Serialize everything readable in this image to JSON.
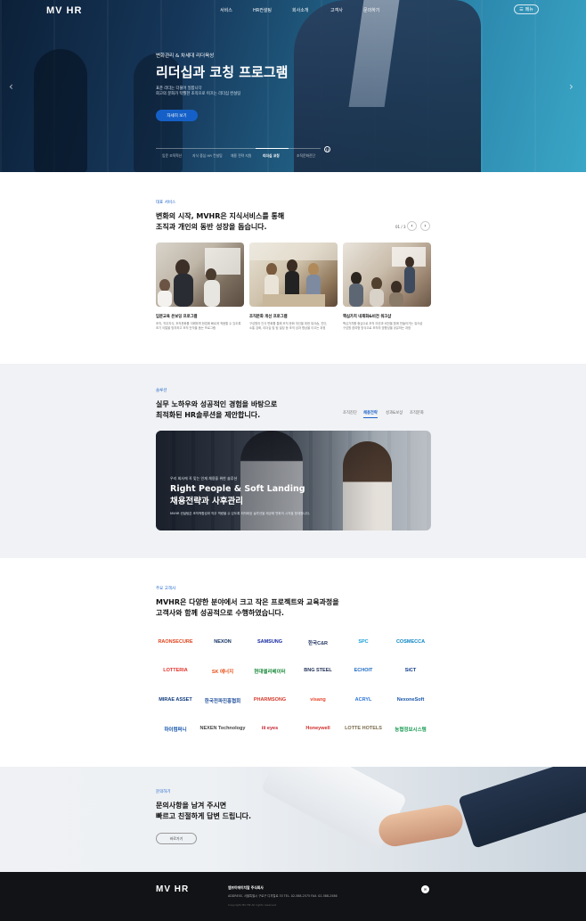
{
  "header": {
    "logo": "MV HR",
    "nav": [
      "서비스",
      "HR컨설팅",
      "회사소개",
      "고객사",
      "문의하기"
    ],
    "menu_label": "메뉴"
  },
  "hero": {
    "eyebrow": "변화관리 & 차세대 리더육성",
    "title": "리더십과 코칭 프로그램",
    "desc_1": "표준 리더는 더불어 일합니다",
    "desc_2": "회고의 문화가 탁월한 조직으로 이끄는 리더십 컨설팅",
    "cta": "자세히 보기",
    "tabs": [
      "입문 조직혁신",
      "지식 중심 HR 컨설팅",
      "채용 전략 지원",
      "리더십 코칭",
      "조직문화진단"
    ],
    "active_tab": 3
  },
  "services": {
    "eyebrow": "대표 서비스",
    "title_1": "변화의 시작, MVHR은 지식서비스를 통해",
    "title_2": "조직과 개인의 동반 성장을 돕습니다.",
    "pager": "01 / 3",
    "cards": [
      {
        "title": "입문교육 온보딩 프로그램",
        "desc_1": "조직, 직무지식, 조직문화를 이해하며 현업에 빠르게 적응할 수 있도록",
        "desc_2": "조기 이탈을 방지하고 조직 안착을 돕는 프로그램"
      },
      {
        "title": "조직문화 개선 프로그램",
        "desc_1": "구성원의 인식 변화를 통해 조직 문화 개선을 위한 워크숍, 진단,",
        "desc_2": "소통 강화, 리더십 및 팀 빌딩 등 조직 성과 향상을 이끄는 과정"
      },
      {
        "title": "핵심가치 내재화&비전 워크샵",
        "desc_1": "핵심가치를 중심으로 조직 미션과 비전을 함께 만들어가는 워크샵",
        "desc_2": "구성원 참여형 방식으로 조직의 방향성을 공유하는 과정"
      }
    ]
  },
  "solutions": {
    "eyebrow": "솔루션",
    "title_1": "실무 노하우와 성공적인 경험을 바탕으로",
    "title_2": "최적화된 HR솔루션을 제안합니다.",
    "tabs": [
      "조직진단",
      "채용전략",
      "성과&보상",
      "조직문화"
    ],
    "active_tab": 1,
    "banner": {
      "eyebrow": "우리 회사에 꼭 맞는 인재 채용을 위한 솔루션",
      "title_1": "Right People & Soft Landing",
      "title_2": "채용전략과 사후관리",
      "desc": "MVHR 컨설팅은 조직적합성과 직무 역량을 수 있도록 최적화된 솔루션을 제공해 변화의 시작을 함께합니다."
    }
  },
  "clients": {
    "eyebrow": "주요 고객사",
    "title_1": "MVHR은 다양한 분야에서 크고 작은 프로젝트와 교육과정을",
    "title_2": "고객사와 함께 성공적으로 수행하였습니다.",
    "logos": [
      {
        "name": "RAONSECURE",
        "color": "#e0431c"
      },
      {
        "name": "NEXON",
        "color": "#0a2a5e"
      },
      {
        "name": "SAMSUNG",
        "color": "#1428a0"
      },
      {
        "name": "한국C&R",
        "color": "#1e2f5d"
      },
      {
        "name": "SPC",
        "color": "#1aa0d8"
      },
      {
        "name": "COSMECCA",
        "color": "#0a84c6"
      },
      {
        "name": "LOTTERIA",
        "color": "#e4322b"
      },
      {
        "name": "SK 에너지",
        "color": "#e85019"
      },
      {
        "name": "현대엘리베이터",
        "color": "#1a8a3b"
      },
      {
        "name": "BNG STEEL",
        "color": "#1e2e55"
      },
      {
        "name": "ECHOIT",
        "color": "#1d6ac4"
      },
      {
        "name": "SiCT",
        "color": "#0b3a8a"
      },
      {
        "name": "MIRAE ASSET",
        "color": "#0f3a7c"
      },
      {
        "name": "한국전파진흥협회",
        "color": "#1d4d9a"
      },
      {
        "name": "PHARMSONG",
        "color": "#d43b2d"
      },
      {
        "name": "visang",
        "color": "#e7452c"
      },
      {
        "name": "ACRYL",
        "color": "#2b74d5"
      },
      {
        "name": "NexoneSoft",
        "color": "#1a56a8"
      },
      {
        "name": "하이컴퍼니",
        "color": "#0f52a8"
      },
      {
        "name": "NEXEN Technology",
        "color": "#444444"
      },
      {
        "name": "iii eyes",
        "color": "#c42030"
      },
      {
        "name": "Honeywell",
        "color": "#d22b2b"
      },
      {
        "name": "LOTTE HOTELS",
        "color": "#7a6a4a"
      },
      {
        "name": "농협정보시스템",
        "color": "#1b9c55"
      }
    ]
  },
  "contact": {
    "eyebrow": "문의하기",
    "title_1": "문의사항을 남겨 주시면",
    "title_2": "빠르고 친절하게 답변 드립니다.",
    "cta": "바로가기"
  },
  "footer": {
    "logo": "MV HR",
    "company": "엠브이에이치알 주식회사",
    "address": "ADDRESS. 서울특별시 구로구 디지털로 33 TEL. 02-588-2575 FAX. 02-588-2586",
    "copyright": "Copyright MV HR All rights reserved."
  }
}
